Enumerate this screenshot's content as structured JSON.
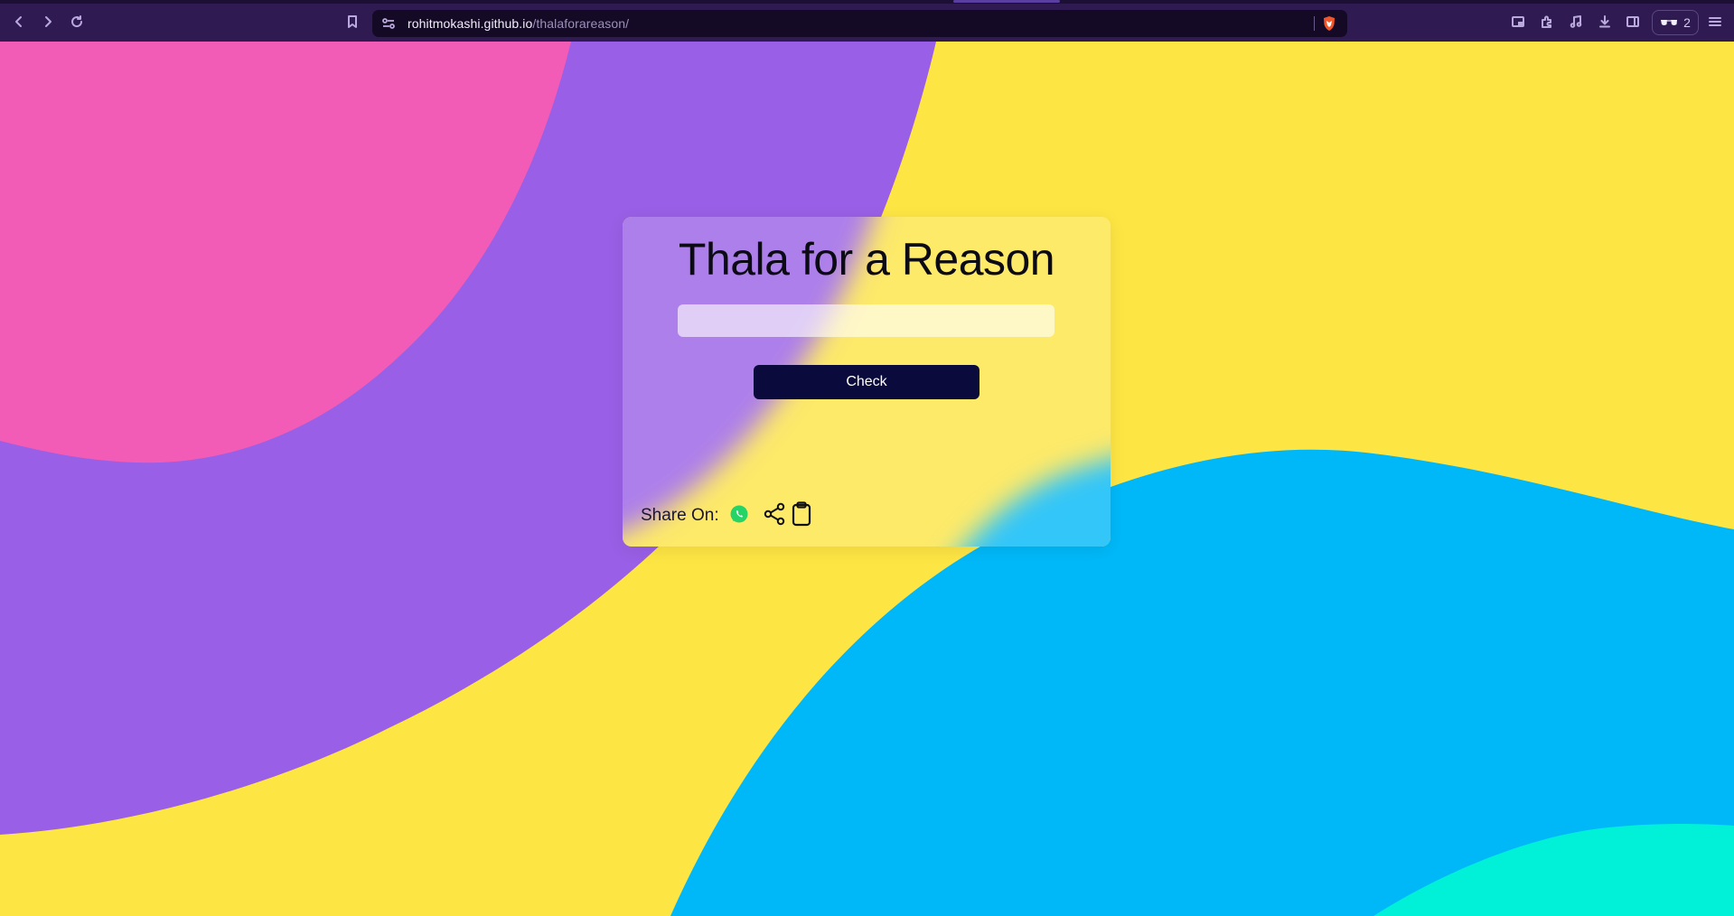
{
  "browser": {
    "url_host": "rohitmokashi.github.io",
    "url_path": "/thalaforareason/",
    "wallet_count": "2",
    "icons": [
      "back-icon",
      "forward-icon",
      "reload-icon",
      "bookmark-icon",
      "site-info-icon",
      "brave-shields-icon",
      "picture-in-picture-icon",
      "extensions-icon",
      "media-icon",
      "downloads-icon",
      "sidebar-icon",
      "wallet-icon",
      "menu-icon"
    ]
  },
  "page": {
    "title": "Thala for a Reason",
    "input_value": "",
    "check_label": "Check",
    "share_label": "Share On:",
    "share_icons": [
      "whatsapp-icon",
      "share-icon",
      "clipboard-icon"
    ]
  },
  "colors": {
    "toolbar": "#2f1b52",
    "background_yellow": "#fde544",
    "pink": "#f25cb6",
    "purple": "#995fe6",
    "blue": "#00b8f8",
    "teal": "#00f0d8",
    "button": "#0a0a3c"
  }
}
